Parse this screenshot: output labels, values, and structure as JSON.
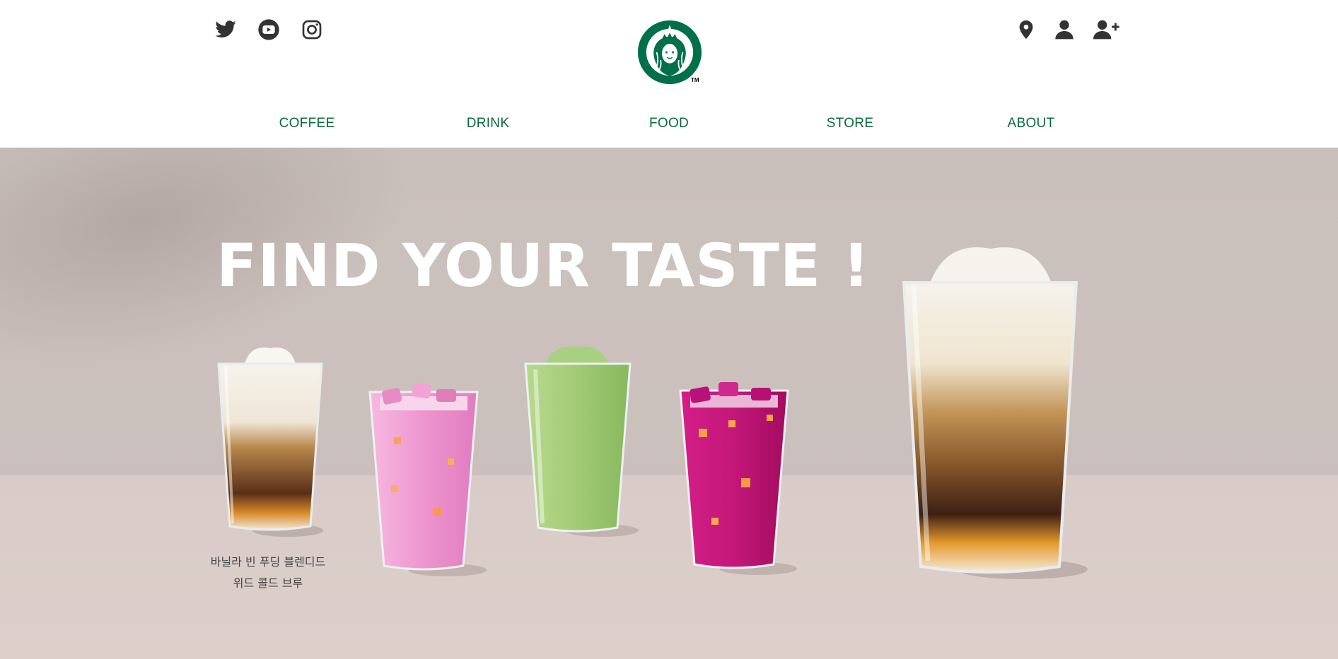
{
  "header": {
    "social": [
      {
        "name": "twitter",
        "icon": "twitter-icon"
      },
      {
        "name": "youtube",
        "icon": "youtube-icon"
      },
      {
        "name": "instagram",
        "icon": "instagram-icon"
      }
    ],
    "user_links": [
      {
        "icon": "map-pin-icon"
      },
      {
        "icon": "user-icon"
      },
      {
        "icon": "user-plus-icon"
      }
    ],
    "logo": {
      "tm": "TM",
      "color": "#00704a"
    }
  },
  "nav": {
    "items": [
      {
        "label": "COFFEE"
      },
      {
        "label": "DRINK"
      },
      {
        "label": "FOOD"
      },
      {
        "label": "STORE"
      },
      {
        "label": "ABOUT"
      }
    ],
    "color": "#0a6a3b"
  },
  "hero": {
    "headline": "FIND YOUR TASTE !",
    "caption_line1": "바닐라 빈 푸딩 블렌디드",
    "caption_line2": "위드 콜드 브루",
    "drinks": [
      {
        "name": "vanilla-cold-brew",
        "colors": [
          "#f3efe6",
          "#b07a3a",
          "#3a1f12"
        ]
      },
      {
        "name": "pink-drink",
        "colors": [
          "#f2a3d6",
          "#e987c8"
        ]
      },
      {
        "name": "matcha-blended",
        "colors": [
          "#a8cc7a",
          "#8dbb5e"
        ]
      },
      {
        "name": "dragonfruit-drink",
        "colors": [
          "#c8177a",
          "#a70e62"
        ]
      },
      {
        "name": "vanilla-cold-brew-large",
        "colors": [
          "#f3efe6",
          "#b07a3a",
          "#3a1f12"
        ]
      }
    ]
  }
}
